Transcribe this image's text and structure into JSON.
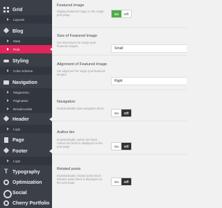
{
  "sidebar": {
    "items": [
      {
        "label": "Grid",
        "type": "main",
        "icon": "grid-icon"
      },
      {
        "label": "Layouts",
        "type": "sub"
      },
      {
        "label": "Blog",
        "type": "main",
        "icon": "pin-icon"
      },
      {
        "label": "Meta",
        "type": "sub"
      },
      {
        "label": "Post",
        "type": "sub",
        "active": true
      },
      {
        "label": "Styling",
        "type": "main",
        "icon": "brush-icon"
      },
      {
        "label": "Color scheme",
        "type": "sub"
      },
      {
        "label": "Navigation",
        "type": "main",
        "icon": "navigation-icon"
      },
      {
        "label": "Megamenu",
        "type": "sub"
      },
      {
        "label": "Pagination",
        "type": "sub"
      },
      {
        "label": "Breadcrumbs",
        "type": "sub"
      },
      {
        "label": "Header",
        "type": "main",
        "icon": "pin-icon"
      },
      {
        "label": "Logo",
        "type": "sub"
      },
      {
        "label": "Page",
        "type": "main",
        "icon": "page-icon"
      },
      {
        "label": "Footer",
        "type": "main",
        "icon": "pin-icon"
      },
      {
        "label": "Logo",
        "type": "sub"
      },
      {
        "label": "Typography",
        "type": "main",
        "icon": "typography-icon"
      },
      {
        "label": "Optimization",
        "type": "main",
        "icon": "gear-icon"
      },
      {
        "label": "Social",
        "type": "main",
        "icon": "share-icon"
      },
      {
        "label": "Cherry Portfolio",
        "type": "main",
        "icon": "gear-icon"
      }
    ]
  },
  "options": {
    "featured_image": {
      "title": "Featured image",
      "desc": "Display featured image on the single post page.",
      "on_label": "On",
      "off_label": "Off",
      "state": "on"
    },
    "featured_size": {
      "title": "Size of Featured Image",
      "desc": "Set dimensions for single post featured images.",
      "value": "Small"
    },
    "featured_alignment": {
      "title": "Alignment of Featured Image",
      "desc": "Set alignment for single post featured images.",
      "value": "Right"
    },
    "navigation": {
      "title": "Navigation",
      "desc": "Enable/disable post navigation block.",
      "on_label": "On",
      "off_label": "Off",
      "state": "off"
    },
    "author_bio": {
      "title": "Author bio",
      "desc": "Enable/disable author bio block. Author bio block is displayed on the post page.",
      "on_label": "On",
      "off_label": "Off",
      "state": "off"
    },
    "related_posts": {
      "title": "Related posts",
      "desc": "Enable/disable related posts block. Related posts block is displayed on the post page.",
      "on_label": "On",
      "off_label": "Off",
      "state": "off"
    }
  },
  "colors": {
    "sidebar_bg": "#3a3f48",
    "active_item": "#e0255a",
    "toggle_on": "#4caa46",
    "toggle_off": "#2f3439"
  }
}
